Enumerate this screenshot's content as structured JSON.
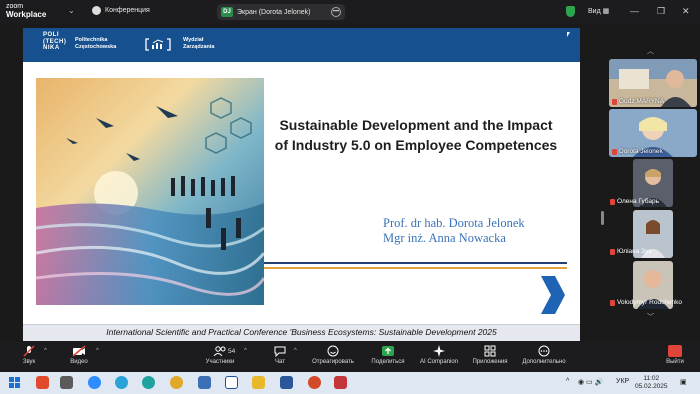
{
  "app": {
    "logo_line1": "zoom",
    "logo_line2": "Workplace"
  },
  "titlebar": {
    "meeting_label": "Конференция",
    "share_badge": "DJ",
    "share_label": "Экран (Dorota Jelonek)",
    "view_label": "Вид"
  },
  "slide": {
    "pol_logo": [
      "POLI",
      "(TECH)",
      "NIKA"
    ],
    "university": [
      "Politechnika",
      "Częstochowska"
    ],
    "faculty": [
      "Wydział",
      "Zarządzania"
    ],
    "title": "Sustainable Development and the Impact of Industry 5.0 on Employee Competences",
    "author1": "Prof. dr hab. Dorota Jelonek",
    "author2": "Mgr inż. Anna Nowacka",
    "footer": "International Scientific and Practical Conference 'Business Ecosystems: Sustainable Development 2025"
  },
  "participants": [
    {
      "name": "Gudz MARYNA",
      "bg": "#6f8a5a"
    },
    {
      "name": "Dorota Jelonek",
      "bg": "#8aa9c9"
    },
    {
      "name": "Олена Губарь",
      "bg": "#5a5f6b"
    },
    {
      "name": "Юліана Зух",
      "bg": "#b9c4cf"
    },
    {
      "name": "Volodymyr Rodchenko",
      "bg": "#c9c3b8"
    }
  ],
  "toolbar": {
    "audio": "Звук",
    "video": "Видео",
    "participants": "Участники",
    "participants_count": "54",
    "chat": "Чат",
    "react": "Отреагировать",
    "share": "Поделиться",
    "companion": "AI Companion",
    "apps": "Приложения",
    "more": "Дополнительно",
    "leave": "Выйти"
  },
  "taskbar": {
    "lang": "УКР",
    "time": "11:02",
    "date": "05.02.2025"
  },
  "colors": {
    "brand_blue": "#16508f",
    "accent_orange": "#e2a23a",
    "mute_red": "#e0453a",
    "share_green": "#2da44e"
  }
}
